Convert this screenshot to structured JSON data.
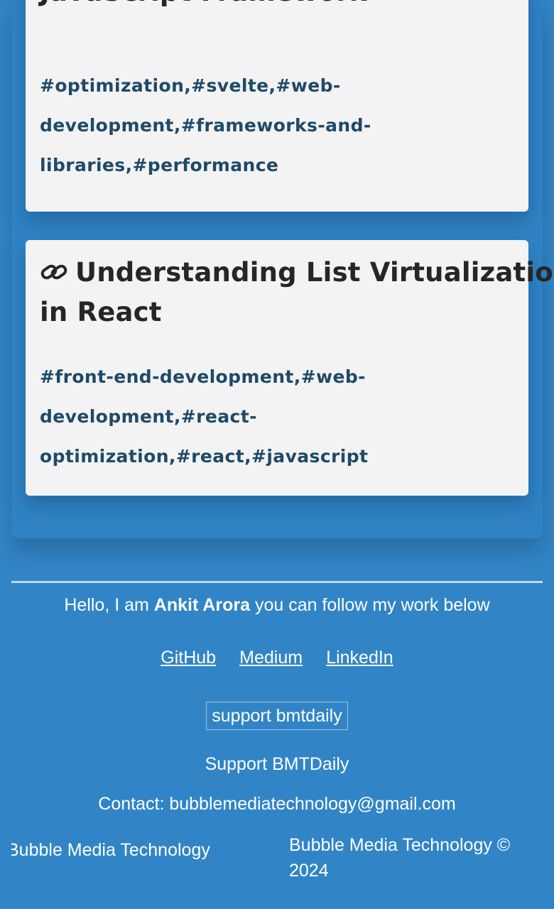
{
  "articles": [
    {
      "title_lines": [
        "JavaScript Framework"
      ],
      "tag_lines": [
        "#optimization,#svelte,#web-",
        "development,#frameworks-and-",
        "libraries,#performance"
      ]
    },
    {
      "icon": "link-icon",
      "title_lines": [
        "Understanding List Virtualization",
        "in React"
      ],
      "tag_lines": [
        "#front-end-development,#web-",
        "development,#react-",
        "optimization,#react,#javascript"
      ]
    }
  ],
  "footer": {
    "hello_prefix": "Hello, I am",
    "author": "Ankit Arora",
    "hello_suffix": "you can follow my work below",
    "links": [
      "GitHub",
      "Medium",
      "LinkedIn"
    ],
    "support_button": "support bmtdaily",
    "support_text": "Support BMTDaily",
    "contact": "Contact: bubblemediatechnology@gmail.com",
    "brand_left": "Bubble Media Technology",
    "brand_right_line1": "Bubble Media Technology ©",
    "brand_right_line2": "2024"
  },
  "colors": {
    "background": "#3185c6",
    "card": "#f3f3f3",
    "title": "#262626",
    "tags": "#1e4a68"
  }
}
